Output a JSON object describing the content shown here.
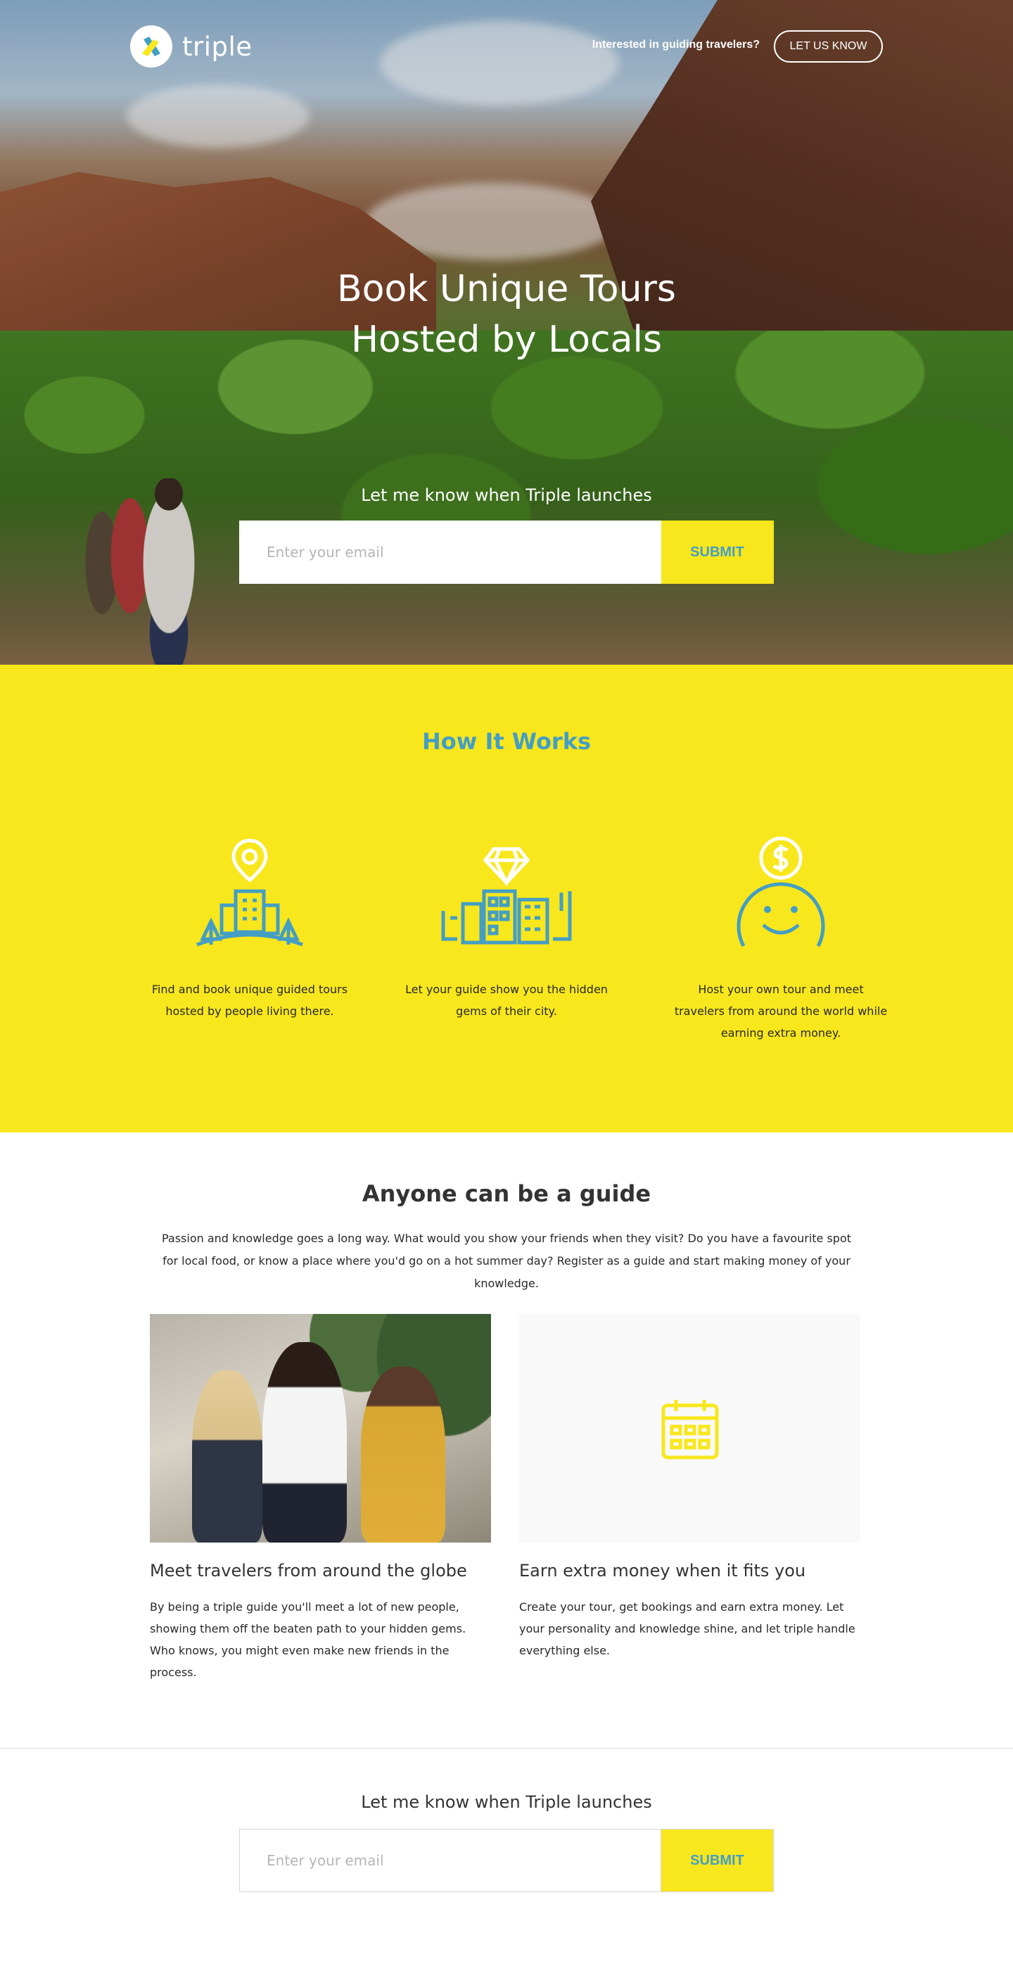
{
  "brand": {
    "name": "triple"
  },
  "header": {
    "guide_prompt": "Interested in guiding travelers?",
    "cta_label": "LET US KNOW"
  },
  "hero": {
    "title_line1": "Book Unique Tours",
    "title_line2": "Hosted by Locals",
    "signup_label": "Let me know when Triple launches",
    "email_placeholder": "Enter your email",
    "submit_label": "SUBMIT"
  },
  "how_it_works": {
    "title": "How It Works",
    "steps": [
      {
        "icon": "city-location-pin-icon",
        "text": "Find and book unique guided tours hosted by people living there."
      },
      {
        "icon": "diamond-city-icon",
        "text": "Let your guide show you the hidden gems of their city."
      },
      {
        "icon": "smiley-dollar-icon",
        "text": "Host your own tour and meet travelers from around the world while earning extra money."
      }
    ]
  },
  "guide": {
    "title": "Anyone can be a guide",
    "intro": "Passion and knowledge goes a long way. What would you show your friends when they visit? Do you have a favourite spot for local food, or know a place where you'd go on a hot summer day? Register as a guide and start making money of your knowledge.",
    "cards": [
      {
        "title": "Meet travelers from around the globe",
        "text": "By being a triple guide you'll meet a lot of new people, showing them off the beaten path to your hidden gems. Who knows, you might even make new friends in the process."
      },
      {
        "title": "Earn extra money when it fits you",
        "text": "Create your tour, get bookings and earn extra money. Let your personality and knowledge shine, and let triple handle everything else."
      }
    ]
  },
  "bottom_signup": {
    "label": "Let me know when Triple launches",
    "email_placeholder": "Enter your email",
    "submit_label": "SUBMIT"
  },
  "colors": {
    "accent_yellow": "#F8E71C",
    "accent_blue": "#449EC4",
    "text_dark": "#292929",
    "heading_dark": "#333333",
    "border": "#D7D7D7"
  }
}
